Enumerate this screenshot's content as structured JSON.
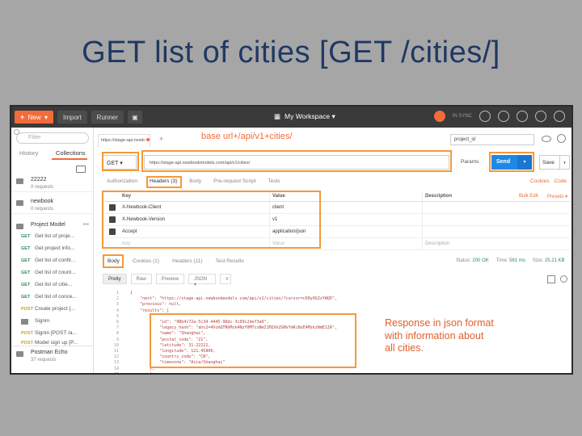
{
  "slide": {
    "title": "GET list of cities [GET /cities/]"
  },
  "topbar": {
    "new_label": "New",
    "import_label": "Import",
    "runner_label": "Runner",
    "workspace_label": "My Workspace ▾",
    "sync_label": "IN SYNC"
  },
  "sidebar": {
    "filter_placeholder": "Filter",
    "tabs": [
      "History",
      "Collections"
    ],
    "collections": [
      {
        "name": "22222",
        "sub": "0 requests"
      },
      {
        "name": "newbook",
        "sub": "0 requests"
      },
      {
        "name": "Project Model",
        "sub": ""
      }
    ],
    "requests": [
      {
        "method": "GET",
        "name": "Get list of proje..."
      },
      {
        "method": "GET",
        "name": "Get project info..."
      },
      {
        "method": "GET",
        "name": "Get list of confir..."
      },
      {
        "method": "GET",
        "name": "Get list of count..."
      },
      {
        "method": "GET",
        "name": "Get list of citie..."
      },
      {
        "method": "GET",
        "name": "Get list of conce..."
      },
      {
        "method": "POST",
        "name": "Create project [..."
      },
      {
        "method": "",
        "name": "Signin"
      },
      {
        "method": "POST",
        "name": "Signin [POST /a..."
      },
      {
        "method": "POST",
        "name": "Model sign up [P..."
      }
    ],
    "bottom_collection": {
      "name": "Postman Echo",
      "sub": "37 requests"
    }
  },
  "request": {
    "tab_label": "https://stage-api.newb",
    "env_label": "project_id",
    "method": "GET",
    "url": "https://stage-api.newbookmodels.com/api/v1/cities/",
    "params_label": "Params",
    "send_label": "Send",
    "save_label": "Save",
    "tabs": [
      "Authorization",
      "Headers (3)",
      "Body",
      "Pre-request Script",
      "Tests"
    ],
    "right_links": [
      "Cookies",
      "Code"
    ]
  },
  "headers": {
    "columns": [
      "Key",
      "Value",
      "Description"
    ],
    "bulk_edit": "Bulk Edit",
    "presets": "Presets ▾",
    "rows": [
      {
        "key": "X-Newbook-Client",
        "value": "client"
      },
      {
        "key": "X-Newbook-Version",
        "value": "v1"
      },
      {
        "key": "Accept",
        "value": "application/json"
      }
    ],
    "empty_key": "Key",
    "empty_value": "Value",
    "empty_desc": "Description"
  },
  "response": {
    "tabs": [
      "Body",
      "Cookies (1)",
      "Headers (11)",
      "Test Results"
    ],
    "status_label": "Status:",
    "status_value": "200 OK",
    "time_label": "Time:",
    "time_value": "561 ms",
    "size_label": "Size:",
    "size_value": "25.21 KB",
    "formats": [
      "Pretty",
      "Raw",
      "Preview"
    ],
    "format_select": "JSON ▾",
    "code": [
      "{",
      "    \"next\": \"https://stage-api.newbookmodels.com/api/v1/cities/?cursor=cD0yOGIzYWQ5\",",
      "    \"previous\": null,",
      "    \"results\": [",
      "        {",
      "            \"id\": \"9Bb4c72a-5c34-4445-98dc-3c09c2def3a0\",",
      "            \"legacy_hash\": \"ahs2=4VcmQTNhMzk4NzY0MTcxNmI1M2VkZGMxYmRiNzE4MzkzNmE1ZA\",",
      "            \"name\": \"Shanghai\",",
      "            \"postal_code\": \"21\",",
      "            \"latitude\": 31.22222,",
      "            \"longitude\": 121.45806,",
      "            \"country_code\": \"CN\",",
      "            \"timezone\": \"Asia/Shanghai\"",
      "        },",
      "        {"
    ]
  },
  "annotations": {
    "url_note": "base url+/api/v1+cities/",
    "json_note_lines": [
      "Response in json format",
      "with information about",
      "all cities."
    ]
  }
}
